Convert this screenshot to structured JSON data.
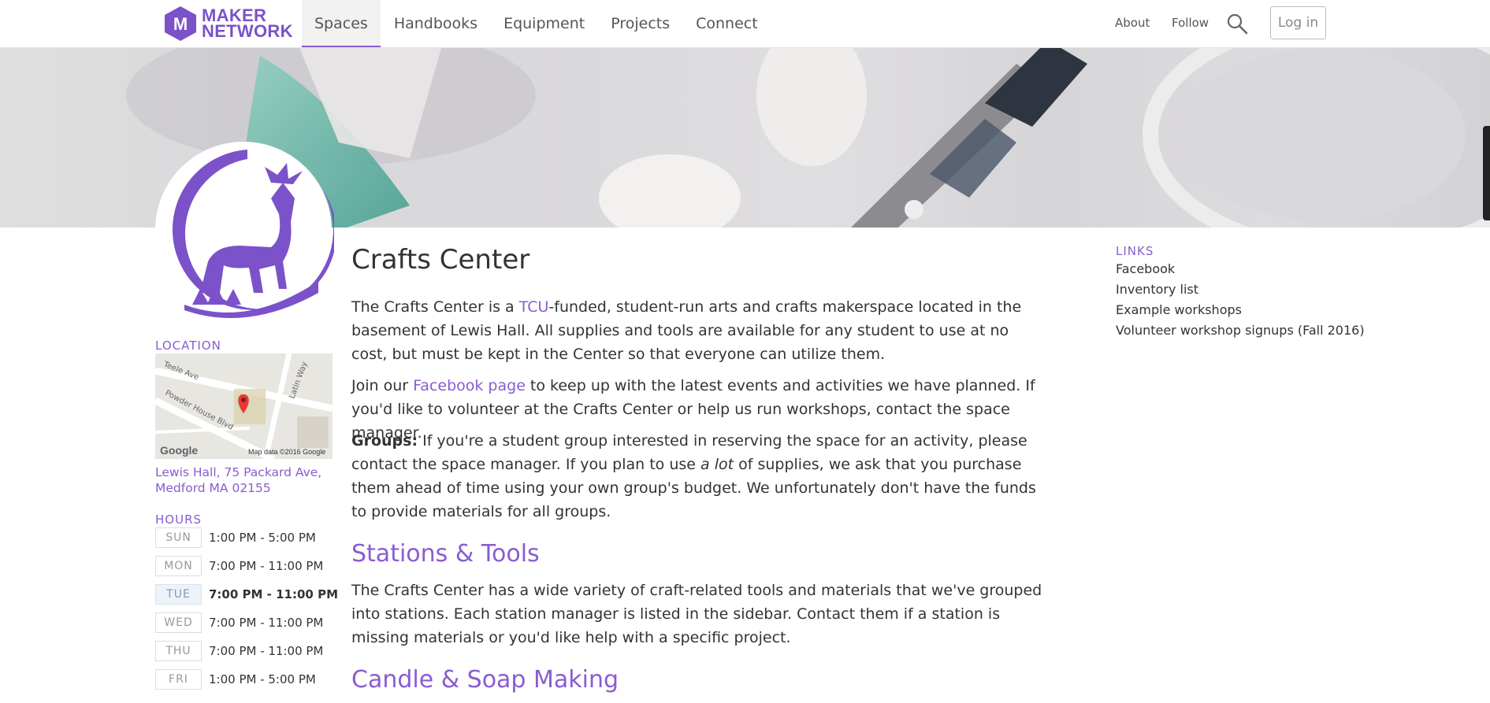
{
  "brand": {
    "letter": "M",
    "line1": "MAKER",
    "line2": "NETWORK",
    "color": "#7b52c9"
  },
  "nav": {
    "items": [
      "Spaces",
      "Handbooks",
      "Equipment",
      "Projects",
      "Connect"
    ],
    "active": "Spaces"
  },
  "right_nav": {
    "about": "About",
    "follow": "Follow",
    "login": "Log in"
  },
  "icons": {
    "search": "search-icon",
    "emblem": "centaur-emblem"
  },
  "sidebar": {
    "location_title": "LOCATION",
    "map": {
      "streets": [
        "Teele Ave",
        "Powder House Blvd",
        "Latin Way"
      ],
      "google": "Google",
      "attribution": "Map data ©2016 Google"
    },
    "address_line1": "Lewis Hall, 75 Packard Ave,",
    "address_line2": "Medford MA 02155",
    "hours_title": "HOURS",
    "hours": [
      {
        "day": "SUN",
        "time": "1:00 PM - 5:00 PM"
      },
      {
        "day": "MON",
        "time": "7:00 PM - 11:00 PM"
      },
      {
        "day": "TUE",
        "time": "7:00 PM - 11:00 PM"
      },
      {
        "day": "WED",
        "time": "7:00 PM - 11:00 PM"
      },
      {
        "day": "THU",
        "time": "7:00 PM - 11:00 PM"
      },
      {
        "day": "FRI",
        "time": "1:00 PM - 5:00 PM"
      }
    ],
    "today": "TUE"
  },
  "main": {
    "title": "Crafts Center",
    "p1": {
      "before": "The Crafts Center is a ",
      "link": "TCU",
      "after": "-funded, student-run arts and crafts makerspace located in the basement of Lewis Hall. All supplies and tools are available for any student to use at no cost, but must be kept in the Center so that everyone can utilize them."
    },
    "p2": {
      "before": "Join our ",
      "link": "Facebook page",
      "after": " to keep up with the latest events and activities we have planned. If you'd like to volunteer at the Crafts Center or help us run workshops, contact the space manager."
    },
    "p3": {
      "bold": "Groups:",
      "before": " If you're a student group interested in reserving the space for an activity, please contact the space manager. If you plan to use ",
      "italic": "a lot",
      "after": " of supplies, we ask that you purchase them ahead of time using your own group's budget. We unfortunately don't have the funds to provide materials for all groups."
    },
    "h_stations": "Stations & Tools",
    "p4": "The Crafts Center has a wide variety of craft-related tools and materials that we've grouped into stations. Each station manager is listed in the sidebar. Contact them if a station is missing materials or you'd like help with a specific project.",
    "h_candle": "Candle & Soap Making"
  },
  "links": {
    "title": "LINKS",
    "items": [
      "Facebook",
      "Inventory list",
      "Example workshops",
      "Volunteer workshop signups (Fall 2016)"
    ]
  },
  "colors": {
    "accent": "#8a5cd1",
    "text": "#333333",
    "today_bg": "#edf3fa"
  }
}
